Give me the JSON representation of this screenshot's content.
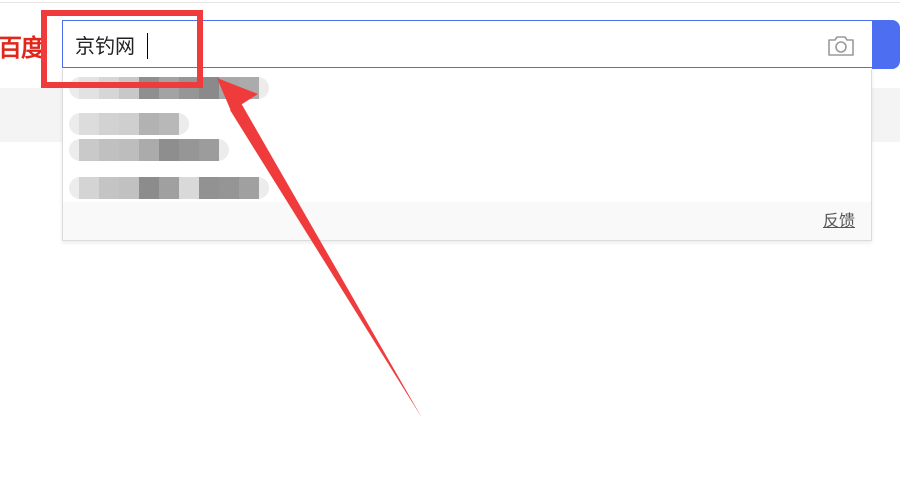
{
  "header": {
    "logo_text": "百度"
  },
  "search": {
    "query": "京钓网",
    "camera_icon": "camera-icon",
    "button_color": "#4e6ef2"
  },
  "dropdown": {
    "suggestions": [
      {
        "blurred": true
      },
      {
        "blurred": true
      },
      {
        "blurred": true
      },
      {
        "blurred": true
      }
    ],
    "feedback_label": "反馈"
  },
  "annotation": {
    "highlight_color": "#ef3b3b",
    "arrow_color": "#ef3b3b"
  }
}
